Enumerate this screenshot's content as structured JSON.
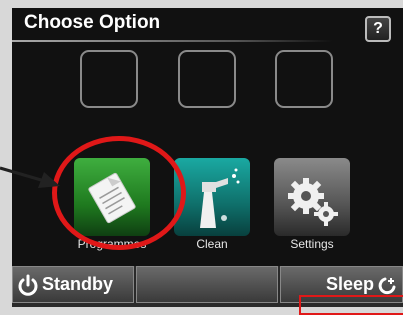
{
  "header": {
    "title": "Choose Option",
    "help_label": "?"
  },
  "options": [
    {
      "label": "Programmes",
      "icon": "document-icon"
    },
    {
      "label": "Clean",
      "icon": "spray-bottle-icon"
    },
    {
      "label": "Settings",
      "icon": "gears-icon"
    }
  ],
  "empty_slots": 3,
  "bottom_bar": {
    "standby_label": "Standby",
    "sleep_label": "Sleep"
  },
  "annotation": {
    "highlighted_option": "Programmes",
    "color": "#e01818"
  }
}
